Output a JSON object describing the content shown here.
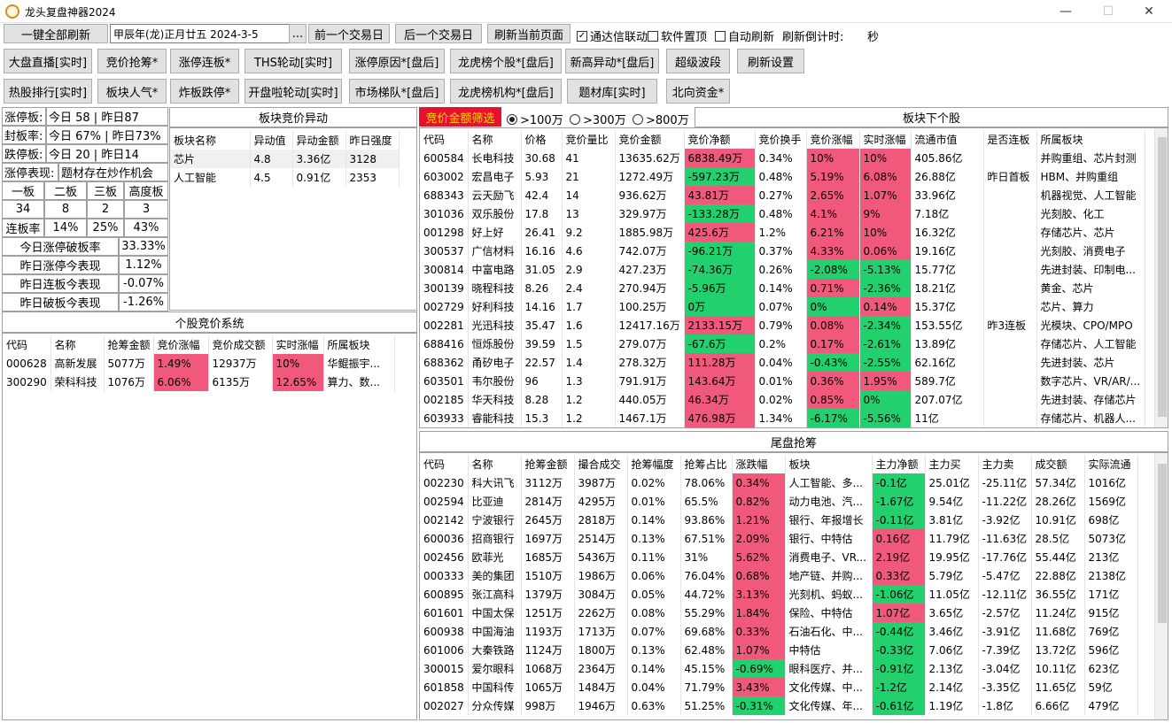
{
  "window": {
    "title": "龙头复盘神器2024",
    "minimize": "—",
    "maximize": "☐",
    "close": "✕"
  },
  "toolbar1": {
    "refresh_all": "一键全部刷新",
    "date_value": "甲辰年(龙)正月廿五  2024-3-5",
    "dots": "...",
    "prev_day": "前一个交易日",
    "next_day": "后一个交易日",
    "refresh_page": "刷新当前页面",
    "chk_tdx": "通达信联动",
    "chk_tdx_checked": "✓",
    "chk_top": "软件置顶",
    "chk_auto": "自动刷新",
    "countdown_label": "刷新倒计时:",
    "countdown_unit": "秒"
  },
  "nav1": [
    "大盘直播[实时]",
    "竞价抢筹*",
    "涨停连板*",
    "THS轮动[实时]",
    "涨停原因*[盘后]",
    "龙虎榜个股*[盘后]",
    "新高异动*[盘后]",
    "超级波段",
    "刷新设置"
  ],
  "nav2": [
    "热股排行[实时]",
    "板块人气*",
    "炸板跌停*",
    "开盘啦轮动[实时]",
    "市场梯队*[盘后]",
    "龙虎榜机构*[盘后]",
    "题材库[实时]",
    "北向资金*"
  ],
  "stats": {
    "zt_label": "涨停板:",
    "zt_value": "今日 58 | 昨日87",
    "fb_label": "封板率:",
    "fb_value": "今日 67% | 昨日73%",
    "dt_label": "跌停板:",
    "dt_value": "今日 20 | 昨日14",
    "bx_label": "涨停表现:",
    "bx_value": "题材存在炒作机会",
    "hdr": [
      "一板",
      "二板",
      "三板",
      "高度板"
    ],
    "vals": [
      "34",
      "8",
      "2",
      "3"
    ],
    "lbl_rate": "连板率",
    "rates": [
      "14%",
      "25%",
      "43%"
    ],
    "rows": [
      {
        "k": "今日涨停破板率",
        "v": "33.33%"
      },
      {
        "k": "昨日涨停今表现",
        "v": "1.12%"
      },
      {
        "k": "昨日连板今表现",
        "v": "-0.07%"
      },
      {
        "k": "昨日破板今表现",
        "v": "-1.26%"
      }
    ]
  },
  "sector_abnormal": {
    "title": "板块竞价异动",
    "columns": [
      "板块名称",
      "异动值",
      "异动金额",
      "昨日强度"
    ],
    "rows": [
      [
        "芯片",
        "4.8",
        "3.36亿",
        "3128"
      ],
      [
        "人工智能",
        "4.5",
        "0.91亿",
        "2353"
      ]
    ]
  },
  "auction": {
    "title": "个股竞价系统",
    "columns": [
      "代码",
      "名称",
      "抢筹金额",
      "竞价涨幅",
      "竞价成交额",
      "实时涨幅",
      "所属板块"
    ],
    "rows": [
      [
        "000628",
        "高新发展",
        "5077万",
        "1.49%",
        "12937万",
        "10%",
        "华鲲振宇..."
      ],
      [
        "300290",
        "荣科科技",
        "1076万",
        "6.06%",
        "6135万",
        "12.65%",
        "算力、数..."
      ]
    ]
  },
  "filter": {
    "label": "竞价金额筛选",
    "opts": [
      ">100万",
      ">300万",
      ">800万"
    ],
    "selected": 0
  },
  "stocks": {
    "title": "板块下个股",
    "columns": [
      "代码",
      "名称",
      "价格",
      "竞价量比",
      "竞价金额",
      "竞价净额",
      "竞价换手",
      "竞价涨幅",
      "实时涨幅",
      "流通市值",
      "是否连板",
      "所属板块"
    ],
    "rows": [
      [
        "600584",
        "长电科技",
        "30.68",
        "41",
        "13635.62万",
        "6838.49万",
        "0.34%",
        "10%",
        "10%",
        "405.86亿",
        "",
        "并购重组、芯片封测"
      ],
      [
        "603002",
        "宏昌电子",
        "5.93",
        "21",
        "1272.49万",
        "-597.23万",
        "0.48%",
        "5.19%",
        "6.08%",
        "26.88亿",
        "昨日首板",
        "HBM、并购重组"
      ],
      [
        "688343",
        "云天励飞",
        "42.4",
        "14",
        "936.62万",
        "43.81万",
        "0.27%",
        "2.65%",
        "1.07%",
        "33.96亿",
        "",
        "机器视觉、人工智能"
      ],
      [
        "301036",
        "双乐股份",
        "17.8",
        "13",
        "329.97万",
        "-133.28万",
        "0.48%",
        "4.1%",
        "9%",
        "7.18亿",
        "",
        "光刻胶、化工"
      ],
      [
        "001298",
        "好上好",
        "26.41",
        "9.2",
        "1885.98万",
        "425.6万",
        "1.2%",
        "6.21%",
        "10%",
        "16.32亿",
        "",
        "存储芯片、芯片"
      ],
      [
        "300537",
        "广信材料",
        "16.16",
        "4.6",
        "742.07万",
        "-96.21万",
        "0.37%",
        "4.33%",
        "0.06%",
        "19.16亿",
        "",
        "光刻胶、消费电子"
      ],
      [
        "300814",
        "中富电路",
        "31.05",
        "2.9",
        "427.23万",
        "-74.36万",
        "0.26%",
        "-2.08%",
        "-5.13%",
        "15.77亿",
        "",
        "先进封装、印制电..."
      ],
      [
        "300139",
        "晓程科技",
        "8.26",
        "2.4",
        "270.94万",
        "-5.96万",
        "0.14%",
        "0.71%",
        "-2.36%",
        "18.21亿",
        "",
        "黄金、芯片"
      ],
      [
        "002729",
        "好利科技",
        "14.16",
        "1.7",
        "100.25万",
        "0万",
        "0.07%",
        "0%",
        "0.14%",
        "15.37亿",
        "",
        "芯片、算力"
      ],
      [
        "002281",
        "光迅科技",
        "35.47",
        "1.6",
        "12417.16万",
        "2133.15万",
        "0.79%",
        "0.08%",
        "-2.34%",
        "153.55亿",
        "昨3连板",
        "光模块、CPO/MPO"
      ],
      [
        "688416",
        "恒烁股份",
        "39.59",
        "1.5",
        "279.07万",
        "-67.6万",
        "0.2%",
        "0.17%",
        "-2.61%",
        "13.89亿",
        "",
        "存储芯片、人工智能"
      ],
      [
        "688362",
        "甬矽电子",
        "22.57",
        "1.4",
        "278.32万",
        "111.28万",
        "0.04%",
        "-0.43%",
        "-2.55%",
        "62.16亿",
        "",
        "先进封装、芯片"
      ],
      [
        "603501",
        "韦尔股份",
        "96",
        "1.3",
        "791.91万",
        "143.64万",
        "0.01%",
        "0.36%",
        "1.95%",
        "589.7亿",
        "",
        "数字芯片、VR/AR/..."
      ],
      [
        "002185",
        "华天科技",
        "8.28",
        "1.2",
        "440.05万",
        "46.34万",
        "0.02%",
        "0.85%",
        "0%",
        "207.07亿",
        "",
        "先进封装、存储芯片"
      ],
      [
        "603933",
        "睿能科技",
        "15.3",
        "1.2",
        "1467.1万",
        "476.98万",
        "1.34%",
        "-6.17%",
        "-5.56%",
        "11亿",
        "",
        "存储芯片、机器人..."
      ]
    ]
  },
  "tail": {
    "title": "尾盘抢筹",
    "columns": [
      "代码",
      "名称",
      "抢筹金额",
      "撮合成交",
      "抢筹幅度",
      "抢筹占比",
      "涨跌幅",
      "板块",
      "主力净额",
      "主力买",
      "主力卖",
      "成交额",
      "实际流通"
    ],
    "rows": [
      [
        "002230",
        "科大讯飞",
        "3112万",
        "3987万",
        "0.02%",
        "78.06%",
        "0.34%",
        "人工智能、多...",
        "-0.1亿",
        "25.01亿",
        "-25.11亿",
        "57.34亿",
        "1016亿"
      ],
      [
        "002594",
        "比亚迪",
        "2814万",
        "4295万",
        "0.01%",
        "65.5%",
        "0.82%",
        "动力电池、汽...",
        "-1.67亿",
        "9.54亿",
        "-11.22亿",
        "28.26亿",
        "1569亿"
      ],
      [
        "002142",
        "宁波银行",
        "2645万",
        "2818万",
        "0.14%",
        "93.86%",
        "1.21%",
        "银行、年报增长",
        "-0.11亿",
        "3.81亿",
        "-3.92亿",
        "10.91亿",
        "698亿"
      ],
      [
        "600036",
        "招商银行",
        "1697万",
        "2514万",
        "0.13%",
        "67.51%",
        "2.09%",
        "银行、中特估",
        "0.16亿",
        "11.79亿",
        "-11.63亿",
        "28.5亿",
        "5073亿"
      ],
      [
        "002456",
        "欧菲光",
        "1685万",
        "5436万",
        "0.11%",
        "31%",
        "5.62%",
        "消费电子、VR...",
        "2.19亿",
        "19.95亿",
        "-17.76亿",
        "55.44亿",
        "213亿"
      ],
      [
        "000333",
        "美的集团",
        "1510万",
        "1986万",
        "0.06%",
        "76.04%",
        "0.68%",
        "地产链、并购...",
        "0.33亿",
        "5.79亿",
        "-5.47亿",
        "22.88亿",
        "2138亿"
      ],
      [
        "600895",
        "张江高科",
        "1379万",
        "3084万",
        "0.05%",
        "44.72%",
        "3.13%",
        "光刻机、蚂蚁...",
        "-1.06亿",
        "11.05亿",
        "-12.11亿",
        "36.55亿",
        "171亿"
      ],
      [
        "601601",
        "中国太保",
        "1251万",
        "2262万",
        "0.08%",
        "55.29%",
        "1.84%",
        "保险、中特估",
        "1.07亿",
        "3.65亿",
        "-2.57亿",
        "11.24亿",
        "915亿"
      ],
      [
        "600938",
        "中国海油",
        "1193万",
        "1713万",
        "0.07%",
        "69.68%",
        "0.33%",
        "石油石化、中...",
        "-0.44亿",
        "3.46亿",
        "-3.91亿",
        "11.68亿",
        "769亿"
      ],
      [
        "601006",
        "大秦铁路",
        "1124万",
        "1800万",
        "0.13%",
        "62.48%",
        "1.07%",
        "中特估",
        "-0.33亿",
        "7.06亿",
        "-7.39亿",
        "13.72亿",
        "596亿"
      ],
      [
        "300015",
        "爱尔眼科",
        "1068万",
        "2364万",
        "0.14%",
        "45.15%",
        "-0.69%",
        "眼科医疗、并...",
        "-0.91亿",
        "2.13亿",
        "-3.04亿",
        "10.11亿",
        "623亿"
      ],
      [
        "601858",
        "中国科传",
        "1065万",
        "1484万",
        "0.04%",
        "71.79%",
        "3.43%",
        "文化传媒、中...",
        "-1.2亿",
        "2.14亿",
        "-3.35亿",
        "11.65亿",
        "59亿"
      ],
      [
        "002027",
        "分众传媒",
        "998万",
        "1946万",
        "0.63%",
        "51.25%",
        "-0.31%",
        "文化传媒、年...",
        "-0.61亿",
        "1.19亿",
        "-1.8亿",
        "6.66亿",
        "479亿"
      ]
    ]
  },
  "colors": {
    "up": "#f0587c",
    "down": "#22d06e",
    "filter_bg": "#e8112d",
    "filter_fg": "#ffd700"
  }
}
